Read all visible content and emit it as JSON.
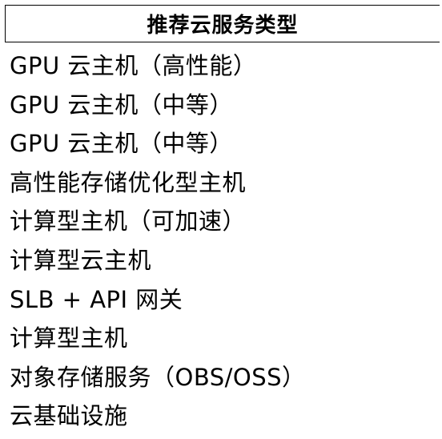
{
  "table": {
    "header": "推荐云服务类型",
    "rows": [
      "GPU 云主机（高性能）",
      "GPU 云主机（中等）",
      "GPU 云主机（中等）",
      "高性能存储优化型主机",
      "计算型主机（可加速）",
      "计算型云主机",
      "SLB + API 网关",
      "计算型主机",
      "对象存储服务（OBS/OSS）",
      "云基础设施"
    ]
  }
}
